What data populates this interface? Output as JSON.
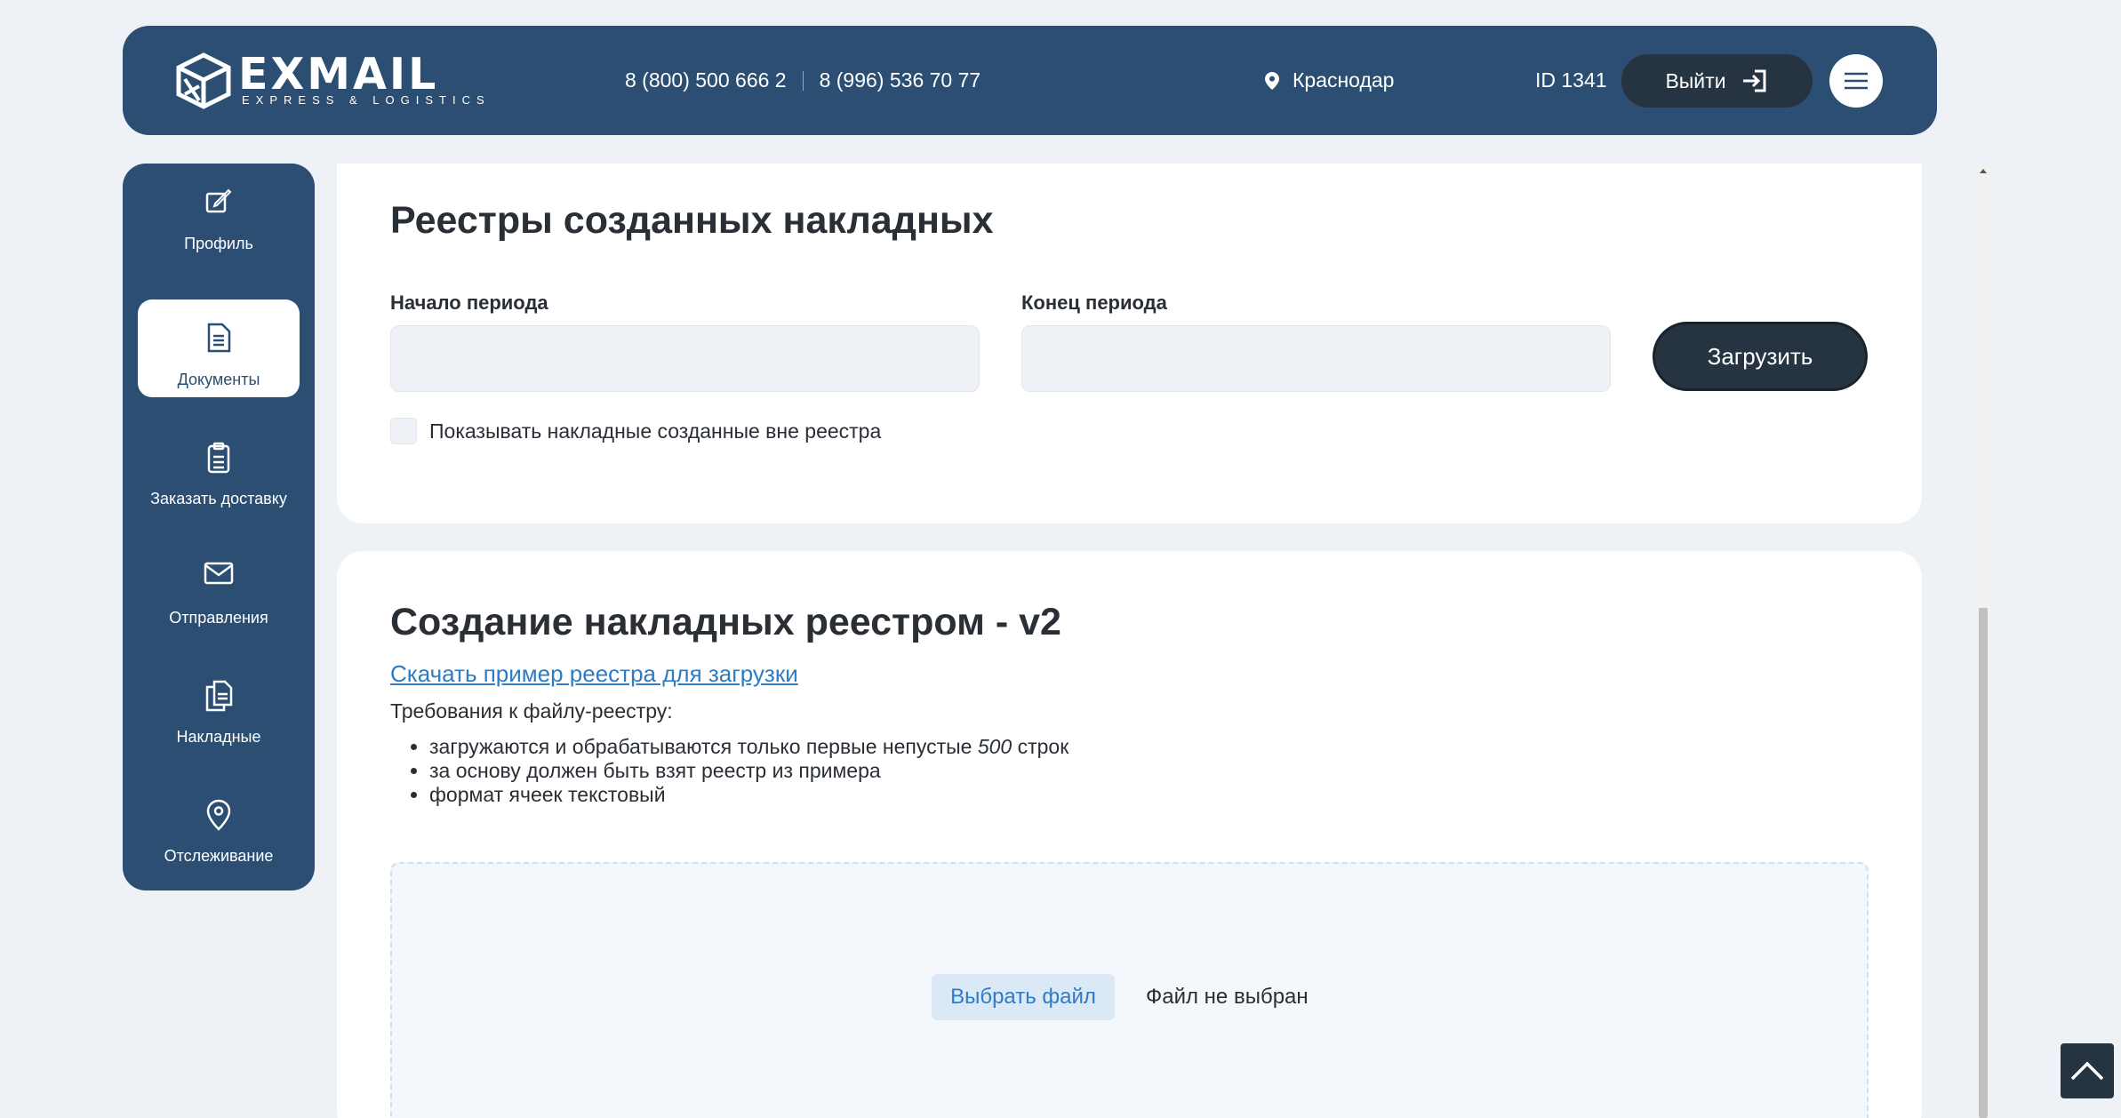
{
  "header": {
    "logo_word": "EXMAIL",
    "logo_sub": "EXPRESS & LOGISTICS",
    "phone1": "8 (800) 500 666 2",
    "phone2": "8 (996) 536 70 77",
    "city": "Краснодар",
    "user_id": "ID 1341",
    "logout_label": "Выйти"
  },
  "sidebar": {
    "items": [
      {
        "label": "Профиль",
        "icon": "edit-icon"
      },
      {
        "label": "Документы",
        "icon": "document-icon",
        "active": true
      },
      {
        "label": "Заказать доставку",
        "icon": "clipboard-icon"
      },
      {
        "label": "Отправления",
        "icon": "envelope-icon"
      },
      {
        "label": "Накладные",
        "icon": "documents-icon"
      },
      {
        "label": "Отслеживание",
        "icon": "location-pin-icon"
      }
    ]
  },
  "registries": {
    "title": "Реестры созданных накладных",
    "start_label": "Начало периода",
    "start_value": "",
    "end_label": "Конец периода",
    "end_value": "",
    "load_button": "Загрузить",
    "checkbox_label": "Показывать накладные созданные вне реестра",
    "checkbox_checked": false
  },
  "create": {
    "title": "Создание накладных реестром - v2",
    "download_link": "Скачать пример реестра для загрузки",
    "requirements_title": "Требования к файлу-реестру:",
    "req1_before": "загружаются и обрабатываются только первые непустые ",
    "req1_number": "500",
    "req1_after": " строк",
    "req2": "за основу должен быть взят реестр из примера",
    "req3": "формат ячеек текстовый",
    "choose_file": "Выбрать файл",
    "file_status": "Файл не выбран"
  },
  "colors": {
    "primary": "#2b4e72",
    "dark": "#263340",
    "background": "#eef2f7",
    "link": "#2f7bc4"
  }
}
